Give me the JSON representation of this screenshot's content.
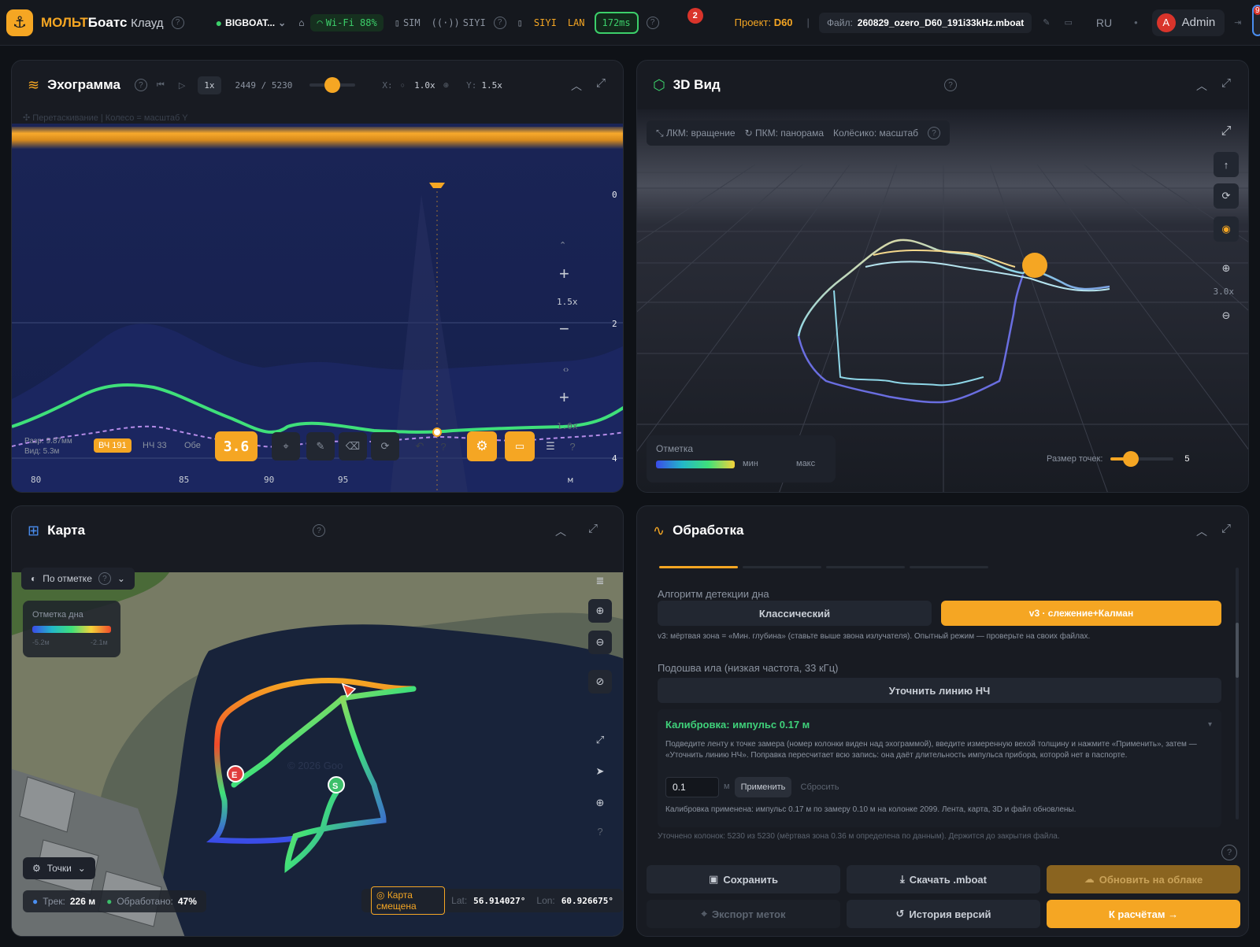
{
  "topbar": {
    "brand_a": "МОЛЬТ",
    "brand_b": "Боатс",
    "brand_c": "Клауд",
    "device": "BIGBOAT...",
    "wifi": "Wi-Fi 88%",
    "sim": "SIM",
    "siyi1": "SIYI",
    "siyi2": "SIYI",
    "lan": "LAN",
    "ping": "172ms",
    "badge": "2",
    "project_label": "Проект:",
    "project_value": "D60",
    "file_label": "Файл:",
    "file_value": "260829_ozero_D60_191i33kHz.mboat",
    "lang": "RU",
    "user_initial": "A",
    "user_name": "Admin",
    "edge_badge": "9"
  },
  "echo": {
    "title": "Эхограмма",
    "speed": "1x",
    "position": "2449 / 5230",
    "x_label": "X:",
    "x_value": "1.0x",
    "y_label": "Y:",
    "y_value": "1.5x",
    "hint": "Перетаскивание | Колесо = масштаб Y",
    "zoom_y": "1.5x",
    "zoom_x": "1.0x",
    "depth_ticks": [
      "0",
      "2",
      "4"
    ],
    "dist_ticks": [
      "80",
      "85",
      "90",
      "95",
      "м"
    ],
    "res_line1": "Разр: 9.87мм",
    "res_line2": "Вид: 5.3м",
    "hf": "ВЧ 191",
    "lf": "НЧ 33",
    "both": "Обе",
    "depth_value": "3.6",
    "slider_fraction": 0.5
  },
  "view3d": {
    "title": "3D Вид",
    "hint_rotate": "ЛКМ: вращение",
    "hint_pan": "ПКМ: панорама",
    "hint_zoom": "Колёсико: масштаб",
    "zoom": "3.0x",
    "legend_title": "Отметка",
    "legend_min": "мин",
    "legend_max": "макс",
    "point_size_label": "Размер точек:",
    "point_size_value": "5"
  },
  "map": {
    "title": "Карта",
    "color_mode": "По отметке",
    "legend_title": "Отметка дна",
    "legend_min": "-5.2м",
    "legend_max": "-2.1м",
    "points_label": "Точки",
    "track_label": "Трек:",
    "track_value": "226 м",
    "processed_label": "Обработано:",
    "processed_value": "47%",
    "shifted_label": "Карта смещена",
    "lat_label": "Lat:",
    "lat_value": "56.914027°",
    "lon_label": "Lon:",
    "lon_value": "60.926675°",
    "marker_end": "E",
    "marker_start": "S",
    "watermark": "© 2026 Goo"
  },
  "processing": {
    "title": "Обработка",
    "algo_label": "Алгоритм детекции дна",
    "algo_classic": "Классический",
    "algo_v3": "v3 · слежение+Калман",
    "algo_note": "v3: мёртвая зона = «Мин. глубина» (ставьте выше звона излучателя). Опытный режим — проверьте на своих файлах.",
    "silt_label": "Подошва ила (низкая частота, 33 кГц)",
    "refine_lf": "Уточнить линию НЧ",
    "calib_title": "Калибровка: импульс 0.17 м",
    "calib_text": "Подведите ленту к точке замера (номер колонки виден над эхограммой), введите измеренную вехой толщину и нажмите «Применить», затем — «Уточнить линию НЧ». Поправка пересчитает всю запись: она даёт длительность импульса прибора, которой нет в паспорте.",
    "calib_input": "0.1",
    "calib_unit": "м",
    "apply": "Применить",
    "reset": "Сбросить",
    "calib_applied": "Калибровка применена: импульс 0.17 м по замеру 0.10 м на колонке 2099. Лента, карта, 3D и файл обновлены.",
    "refined_cols": "Уточнено колонок: 5230 из 5230 (мёртвая зона 0.36 м определена по данным). Держится до закрытия файла.",
    "save": "Сохранить",
    "download": "Скачать .mboat",
    "update_cloud": "Обновить на облаке",
    "export_marks": "Экспорт меток",
    "history": "История версий",
    "to_calc": "К расчётам →"
  }
}
